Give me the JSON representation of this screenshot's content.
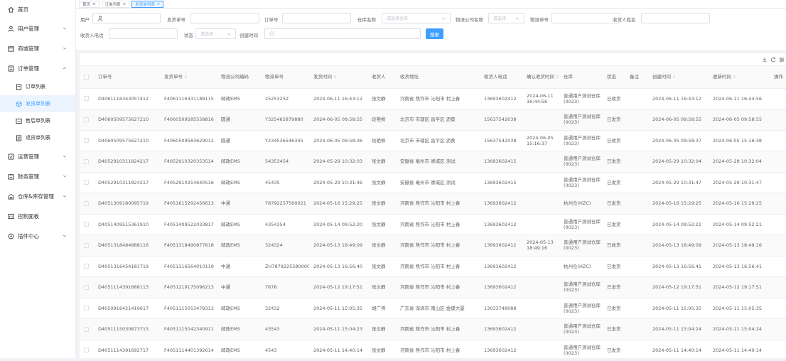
{
  "sidebar": {
    "items": [
      {
        "label": "首页",
        "icon": "home-icon"
      },
      {
        "label": "用户管理",
        "icon": "user-icon"
      },
      {
        "label": "商城管理",
        "icon": "shop-icon"
      },
      {
        "label": "订单管理",
        "icon": "order-icon"
      },
      {
        "label": "订单列表",
        "icon": "list-icon"
      },
      {
        "label": "发货单列表",
        "icon": "package-icon"
      },
      {
        "label": "售后单列表",
        "icon": "refund-icon"
      },
      {
        "label": "退货单列表",
        "icon": "return-icon"
      },
      {
        "label": "运营管理",
        "icon": "operations-icon"
      },
      {
        "label": "财务管理",
        "icon": "finance-icon"
      },
      {
        "label": "仓库&库存管理",
        "icon": "warehouse-icon"
      },
      {
        "label": "控制面板",
        "icon": "dashboard-icon"
      },
      {
        "label": "插件中心",
        "icon": "plugin-icon"
      }
    ]
  },
  "tabs": [
    {
      "label": "首页"
    },
    {
      "label": "订单列表"
    },
    {
      "label": "发货单列表"
    }
  ],
  "filters": {
    "user_label": "用户",
    "shipping_no_label": "发货单号",
    "order_no_label": "订单号",
    "warehouse_label": "仓库名称",
    "warehouse_placeholder": "请选择仓库",
    "logistics_company_label": "物流公司名称",
    "logistics_company_placeholder": "请选择",
    "logistics_no_label": "物流单号",
    "receiver_name_label": "收货人姓名",
    "receiver_phone_label": "收货人电话",
    "status_label": "状态",
    "status_placeholder": "请选择",
    "created_time_label": "创建时间",
    "date_separator": "-",
    "search_button": "搜索"
  },
  "table": {
    "headers": [
      "订单号",
      "发货单号",
      "物流公司编码",
      "物流单号",
      "发货时间",
      "收货人",
      "收货地址",
      "收货人电话",
      "确认收货时间",
      "仓库",
      "状态",
      "备注",
      "创建时间",
      "更新时间",
      "操作"
    ],
    "rows": [
      [
        "D4061116343057412",
        "F4061116431188115",
        "邮政EMS",
        "25253252",
        "2024-06-11 16:43:12",
        "张文静",
        "河南省 焦作市 沁阳市 村上春",
        "13693602412",
        "2024-06-11 16:44:56",
        "普通用户测试仓库(0023)",
        "已收货",
        "",
        "2024-06-11 16:43:12",
        "2024-06-11 16:44:56"
      ],
      [
        "D4060509575627210",
        "F4060509585558816",
        "圆通",
        "Y325465879880",
        "2024-06-05 09:58:55",
        "段艳柳",
        "北京市 市辖区 昌平区 沥葵",
        "15637542038",
        "",
        "普通用户测试仓库(0023)",
        "已发货",
        "",
        "2024-06-05 09:58:55",
        "2024-06-05 09:58:55"
      ],
      [
        "D4060509575627210",
        "F4060509583629012",
        "圆通",
        "Y234536546345",
        "2024-06-05 09:58:36",
        "段艳柳",
        "北京市 市辖区 昌平区 沥葵",
        "15637542038",
        "2024-06-05 15:16:37",
        "普通用户测试仓库(0023)",
        "已收货",
        "",
        "2024-06-05 09:58:37",
        "2024-06-05 15:16:38"
      ],
      [
        "D4052910311824217",
        "F4052910320353514",
        "邮政EMS",
        "54353454",
        "2024-05-29 10:32:03",
        "张文静",
        "安徽省 亳州市 谯城区 测试",
        "13693602415",
        "",
        "普通用户测试仓库(0023)",
        "已发货",
        "",
        "2024-05-29 10:32:04",
        "2024-05-29 10:32:04"
      ],
      [
        "D4052910311824217",
        "F4052910314640516",
        "邮政EMS",
        "45435",
        "2024-05-29 10:31:46",
        "张文静",
        "安徽省 亳州市 谯城区 测试",
        "13693602415",
        "",
        "普通用户测试仓库(0023)",
        "已发货",
        "",
        "2024-05-29 10:31:47",
        "2024-05-29 10:31:47"
      ],
      [
        "D4051309180095719",
        "F4051615292456613",
        "中通",
        "78792257500021",
        "2024-05-16 15:29:25",
        "张文静",
        "河南省 焦作市 沁阳市 村上春",
        "13693602412",
        "",
        "杭州仓(HZC)",
        "已发货",
        "",
        "2024-05-16 15:29:25",
        "2024-05-16 15:29:25"
      ],
      [
        "D4051409515361910",
        "F4051409522033817",
        "邮政EMS",
        "4354354",
        "2024-05-14 09:52:20",
        "张文静",
        "河南省 焦作市 沁阳市 村上春",
        "13693602412",
        "",
        "普通用户测试仓库(0023)",
        "已发货",
        "",
        "2024-05-14 09:52:21",
        "2024-05-14 09:52:21"
      ],
      [
        "D4051318484888116",
        "F4051318490877618",
        "邮政EMS",
        "324324",
        "2024-05-13 18:49:09",
        "张文静",
        "河南省 焦作市 沁阳市 村上春",
        "13693602412",
        "2024-05-13 18:49:16",
        "普通用户测试仓库(0023)",
        "已收货",
        "",
        "2024-05-13 18:49:09",
        "2024-05-13 18:49:16"
      ],
      [
        "D4051316454181719",
        "F4051316564010119",
        "中通",
        "ZH78792255800004",
        "2024-05-13 16:56:40",
        "张文静",
        "河南省 焦作市 沁阳市 村上春",
        "13693602412",
        "",
        "杭州仓(HZC)",
        "已发货",
        "",
        "2024-05-13 16:56:41",
        "2024-05-13 16:56:41"
      ],
      [
        "D4051114391688113",
        "F4051219175096213",
        "中通",
        "7878",
        "2024-05-12 19:17:51",
        "张文静",
        "河南省 焦作市 沁阳市 村上春",
        "13693602412",
        "",
        "普通用户测试仓库(0023)",
        "已发货",
        "",
        "2024-05-12 19:17:51",
        "2024-05-12 19:17:51"
      ],
      [
        "D4050916421419617",
        "F4051115053478313",
        "邮政EMS",
        "32432",
        "2024-05-11 15:05:35",
        "胡广伟",
        "广东省 深圳市 南山区 金蝶大厦",
        "13033748088",
        "",
        "普通用户测试仓库(0023)",
        "已发货",
        "",
        "2024-05-11 15:05:35",
        "2024-05-11 15:05:35"
      ],
      [
        "D4051115030873715",
        "F4051115042340911",
        "邮政EMS",
        "43543",
        "2024-05-11 15:04:23",
        "张文静",
        "河南省 焦作市 沁阳市 村上春",
        "13693602412",
        "",
        "普通用户测试仓库(0023)",
        "已发货",
        "",
        "2024-05-11 15:04:24",
        "2024-05-11 15:04:24"
      ],
      [
        "D4051114391692717",
        "F4051114401392614",
        "邮政EMS",
        "4543",
        "2024-05-11 14:40:14",
        "张文静",
        "河南省 焦作市 沁阳市 村上春",
        "13693602412",
        "",
        "普通用户测试仓库(0023)",
        "已发货",
        "",
        "2024-05-11 14:40:14",
        "2024-05-11 14:40:14"
      ]
    ]
  },
  "colors": {
    "accent": "#409eff",
    "text": "#606266",
    "border": "#dcdfe6"
  }
}
